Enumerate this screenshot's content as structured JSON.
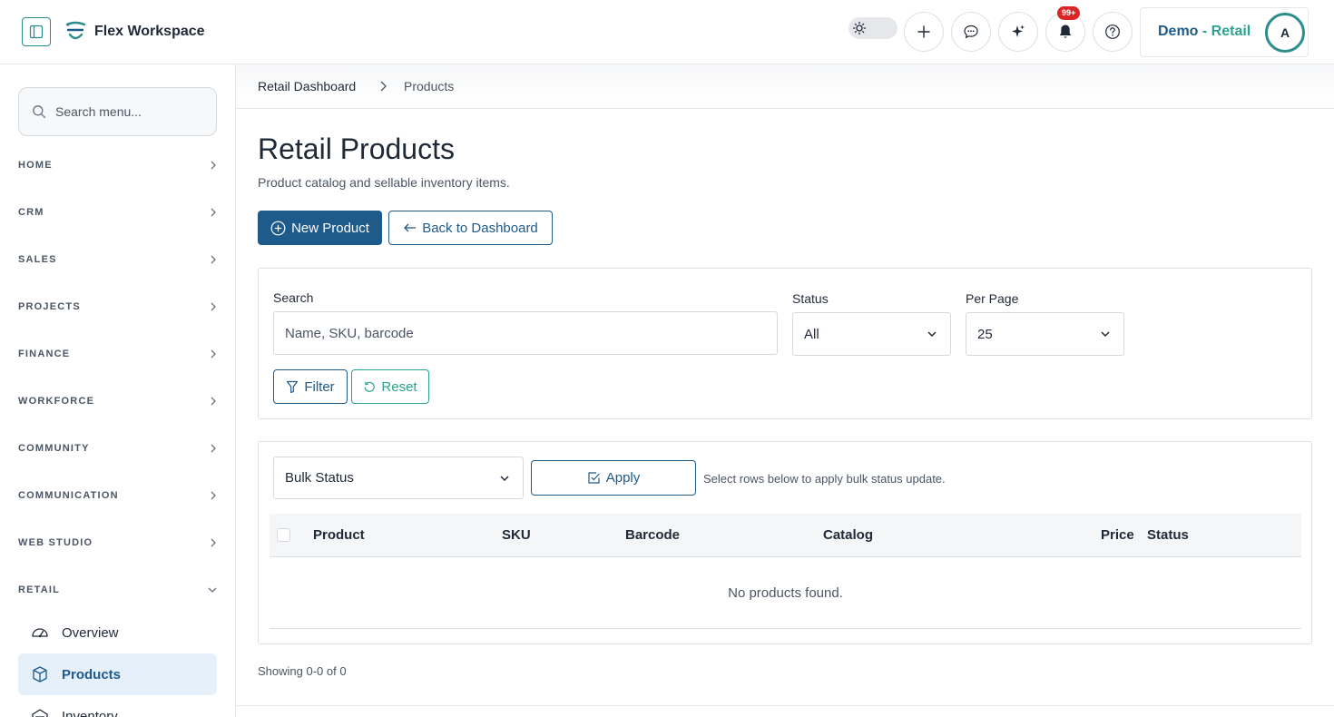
{
  "header": {
    "brand_name": "Flex Workspace",
    "workspace_name_prefix": "Demo",
    "workspace_name_separator": " - ",
    "workspace_name_suffix": "Retail",
    "avatar_initial": "A",
    "notifications_badge": "99+"
  },
  "sidebar": {
    "search_placeholder": "Search menu...",
    "sections": [
      "HOME",
      "CRM",
      "SALES",
      "PROJECTS",
      "FINANCE",
      "WORKFORCE",
      "COMMUNITY",
      "COMMUNICATION",
      "WEB STUDIO",
      "RETAIL"
    ],
    "retail_items": [
      {
        "label": "Overview",
        "icon": "dashboard-gauge-icon",
        "active": false
      },
      {
        "label": "Products",
        "icon": "box-icon",
        "active": true
      },
      {
        "label": "Inventory",
        "icon": "warehouse-icon",
        "active": false
      }
    ]
  },
  "breadcrumb": {
    "parent": "Retail Dashboard",
    "current": "Products"
  },
  "page": {
    "title": "Retail Products",
    "subtitle": "Product catalog and sellable inventory items.",
    "new_button": "New Product",
    "back_button": "Back to Dashboard"
  },
  "filters": {
    "search_label": "Search",
    "search_placeholder": "Name, SKU, barcode",
    "status_label": "Status",
    "status_value": "All",
    "per_page_label": "Per Page",
    "per_page_value": "25",
    "filter_button": "Filter",
    "reset_button": "Reset"
  },
  "table": {
    "bulk_status_value": "Bulk Status",
    "apply_button": "Apply",
    "bulk_hint": "Select rows below to apply bulk status update.",
    "columns": [
      "Product",
      "SKU",
      "Barcode",
      "Catalog",
      "Price",
      "Status"
    ],
    "empty_message": "No products found.",
    "showing": "Showing 0-0 of 0"
  },
  "colors": {
    "primary": "#1e5a8a",
    "accent": "#2aa38f",
    "badge": "#dc2626",
    "active_bg": "#e6f0fa"
  }
}
